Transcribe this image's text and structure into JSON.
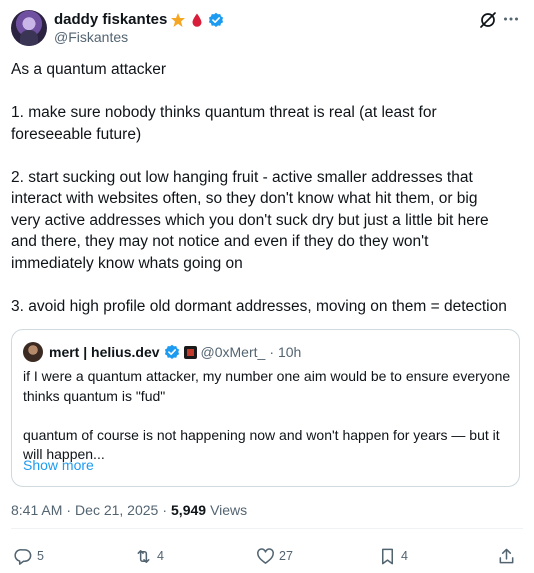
{
  "author": {
    "display_name": "daddy fiskantes",
    "handle": "@Fiskantes",
    "badges": [
      "star-badge",
      "blood-drop-badge",
      "verified-badge"
    ]
  },
  "body": {
    "paragraphs": [
      "As a quantum attacker",
      "1. make sure nobody thinks quantum threat is real (at least for\nforeseeable future)",
      "2. start sucking out low hanging fruit - active smaller addresses that\ninteract with websites often, so they don't know what hit them, or big\nvery active addresses which you don't suck dry but just a little bit here\nand there, they may not notice and even if they do they won't\nimmediately know whats going on",
      "3. avoid high profile old dormant addresses, moving on them = detection"
    ]
  },
  "quote": {
    "display_name": "mert | helius.dev",
    "handle": "@0xMert_",
    "time": "10h",
    "text": "if I were a quantum attacker, my number one aim would be to ensure everyone\nthinks quantum is \"fud\"\n\nquantum of course is not happening now and won't happen for years — but it\nwill happen...",
    "show_more": "Show more"
  },
  "meta": {
    "time": "8:41 AM",
    "date": "Dec 21, 2025",
    "views": "5,949",
    "views_label": "Views"
  },
  "actions": {
    "replies": "5",
    "reposts": "4",
    "likes": "27",
    "bookmarks": "4"
  },
  "colors": {
    "text": "#0f1419",
    "secondary": "#536471",
    "link": "#1d9bf0",
    "verified": "#1d9bf0",
    "border": "#cfd9de"
  }
}
